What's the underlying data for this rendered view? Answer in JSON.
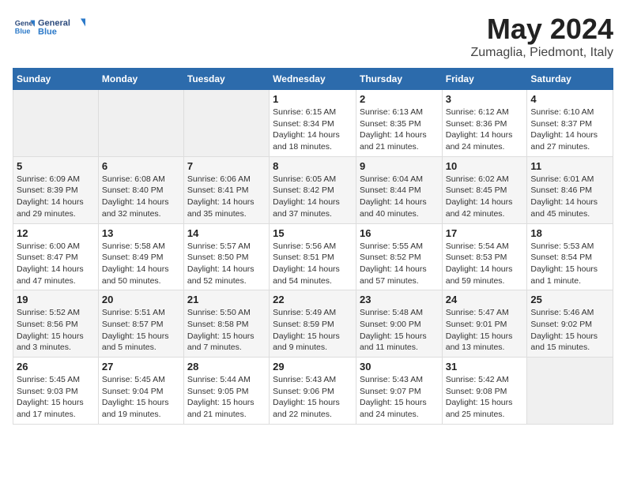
{
  "header": {
    "logo_line1": "General",
    "logo_line2": "Blue",
    "month_year": "May 2024",
    "location": "Zumaglia, Piedmont, Italy"
  },
  "columns": [
    "Sunday",
    "Monday",
    "Tuesday",
    "Wednesday",
    "Thursday",
    "Friday",
    "Saturday"
  ],
  "weeks": [
    [
      {
        "day": "",
        "info": ""
      },
      {
        "day": "",
        "info": ""
      },
      {
        "day": "",
        "info": ""
      },
      {
        "day": "1",
        "info": "Sunrise: 6:15 AM\nSunset: 8:34 PM\nDaylight: 14 hours\nand 18 minutes."
      },
      {
        "day": "2",
        "info": "Sunrise: 6:13 AM\nSunset: 8:35 PM\nDaylight: 14 hours\nand 21 minutes."
      },
      {
        "day": "3",
        "info": "Sunrise: 6:12 AM\nSunset: 8:36 PM\nDaylight: 14 hours\nand 24 minutes."
      },
      {
        "day": "4",
        "info": "Sunrise: 6:10 AM\nSunset: 8:37 PM\nDaylight: 14 hours\nand 27 minutes."
      }
    ],
    [
      {
        "day": "5",
        "info": "Sunrise: 6:09 AM\nSunset: 8:39 PM\nDaylight: 14 hours\nand 29 minutes."
      },
      {
        "day": "6",
        "info": "Sunrise: 6:08 AM\nSunset: 8:40 PM\nDaylight: 14 hours\nand 32 minutes."
      },
      {
        "day": "7",
        "info": "Sunrise: 6:06 AM\nSunset: 8:41 PM\nDaylight: 14 hours\nand 35 minutes."
      },
      {
        "day": "8",
        "info": "Sunrise: 6:05 AM\nSunset: 8:42 PM\nDaylight: 14 hours\nand 37 minutes."
      },
      {
        "day": "9",
        "info": "Sunrise: 6:04 AM\nSunset: 8:44 PM\nDaylight: 14 hours\nand 40 minutes."
      },
      {
        "day": "10",
        "info": "Sunrise: 6:02 AM\nSunset: 8:45 PM\nDaylight: 14 hours\nand 42 minutes."
      },
      {
        "day": "11",
        "info": "Sunrise: 6:01 AM\nSunset: 8:46 PM\nDaylight: 14 hours\nand 45 minutes."
      }
    ],
    [
      {
        "day": "12",
        "info": "Sunrise: 6:00 AM\nSunset: 8:47 PM\nDaylight: 14 hours\nand 47 minutes."
      },
      {
        "day": "13",
        "info": "Sunrise: 5:58 AM\nSunset: 8:49 PM\nDaylight: 14 hours\nand 50 minutes."
      },
      {
        "day": "14",
        "info": "Sunrise: 5:57 AM\nSunset: 8:50 PM\nDaylight: 14 hours\nand 52 minutes."
      },
      {
        "day": "15",
        "info": "Sunrise: 5:56 AM\nSunset: 8:51 PM\nDaylight: 14 hours\nand 54 minutes."
      },
      {
        "day": "16",
        "info": "Sunrise: 5:55 AM\nSunset: 8:52 PM\nDaylight: 14 hours\nand 57 minutes."
      },
      {
        "day": "17",
        "info": "Sunrise: 5:54 AM\nSunset: 8:53 PM\nDaylight: 14 hours\nand 59 minutes."
      },
      {
        "day": "18",
        "info": "Sunrise: 5:53 AM\nSunset: 8:54 PM\nDaylight: 15 hours\nand 1 minute."
      }
    ],
    [
      {
        "day": "19",
        "info": "Sunrise: 5:52 AM\nSunset: 8:56 PM\nDaylight: 15 hours\nand 3 minutes."
      },
      {
        "day": "20",
        "info": "Sunrise: 5:51 AM\nSunset: 8:57 PM\nDaylight: 15 hours\nand 5 minutes."
      },
      {
        "day": "21",
        "info": "Sunrise: 5:50 AM\nSunset: 8:58 PM\nDaylight: 15 hours\nand 7 minutes."
      },
      {
        "day": "22",
        "info": "Sunrise: 5:49 AM\nSunset: 8:59 PM\nDaylight: 15 hours\nand 9 minutes."
      },
      {
        "day": "23",
        "info": "Sunrise: 5:48 AM\nSunset: 9:00 PM\nDaylight: 15 hours\nand 11 minutes."
      },
      {
        "day": "24",
        "info": "Sunrise: 5:47 AM\nSunset: 9:01 PM\nDaylight: 15 hours\nand 13 minutes."
      },
      {
        "day": "25",
        "info": "Sunrise: 5:46 AM\nSunset: 9:02 PM\nDaylight: 15 hours\nand 15 minutes."
      }
    ],
    [
      {
        "day": "26",
        "info": "Sunrise: 5:45 AM\nSunset: 9:03 PM\nDaylight: 15 hours\nand 17 minutes."
      },
      {
        "day": "27",
        "info": "Sunrise: 5:45 AM\nSunset: 9:04 PM\nDaylight: 15 hours\nand 19 minutes."
      },
      {
        "day": "28",
        "info": "Sunrise: 5:44 AM\nSunset: 9:05 PM\nDaylight: 15 hours\nand 21 minutes."
      },
      {
        "day": "29",
        "info": "Sunrise: 5:43 AM\nSunset: 9:06 PM\nDaylight: 15 hours\nand 22 minutes."
      },
      {
        "day": "30",
        "info": "Sunrise: 5:43 AM\nSunset: 9:07 PM\nDaylight: 15 hours\nand 24 minutes."
      },
      {
        "day": "31",
        "info": "Sunrise: 5:42 AM\nSunset: 9:08 PM\nDaylight: 15 hours\nand 25 minutes."
      },
      {
        "day": "",
        "info": ""
      }
    ]
  ]
}
